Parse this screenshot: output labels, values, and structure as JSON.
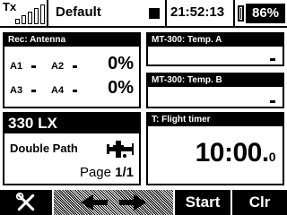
{
  "topbar": {
    "tx_label": "Tx",
    "model_name": "Default",
    "clock": "21:52:13",
    "battery_percent": "86%",
    "battery_level": 0.86,
    "signal_bars": 5
  },
  "antenna": {
    "title": "Rec: Antenna",
    "a1": "A1",
    "a2": "A2",
    "a3": "A3",
    "a4": "A4",
    "pct_top": "0%",
    "pct_bottom": "0%"
  },
  "temp_a": {
    "title": "MT-300: Temp. A",
    "value_icon": "dash"
  },
  "temp_b": {
    "title": "MT-300: Temp. B",
    "value_icon": "dash"
  },
  "model": {
    "title": "330 LX",
    "mode": "Double Path",
    "page_prefix": "Page ",
    "page_value": "1/1",
    "icon": "airplane-icon"
  },
  "timer": {
    "title": "T: Flight timer",
    "value_main": "10:00.",
    "value_dec": "0"
  },
  "softkeys": {
    "tools_icon": "wrench-screwdriver-icon",
    "nav_icon": "left-right-arrows-icon",
    "start": "Start",
    "clr": "Clr"
  }
}
